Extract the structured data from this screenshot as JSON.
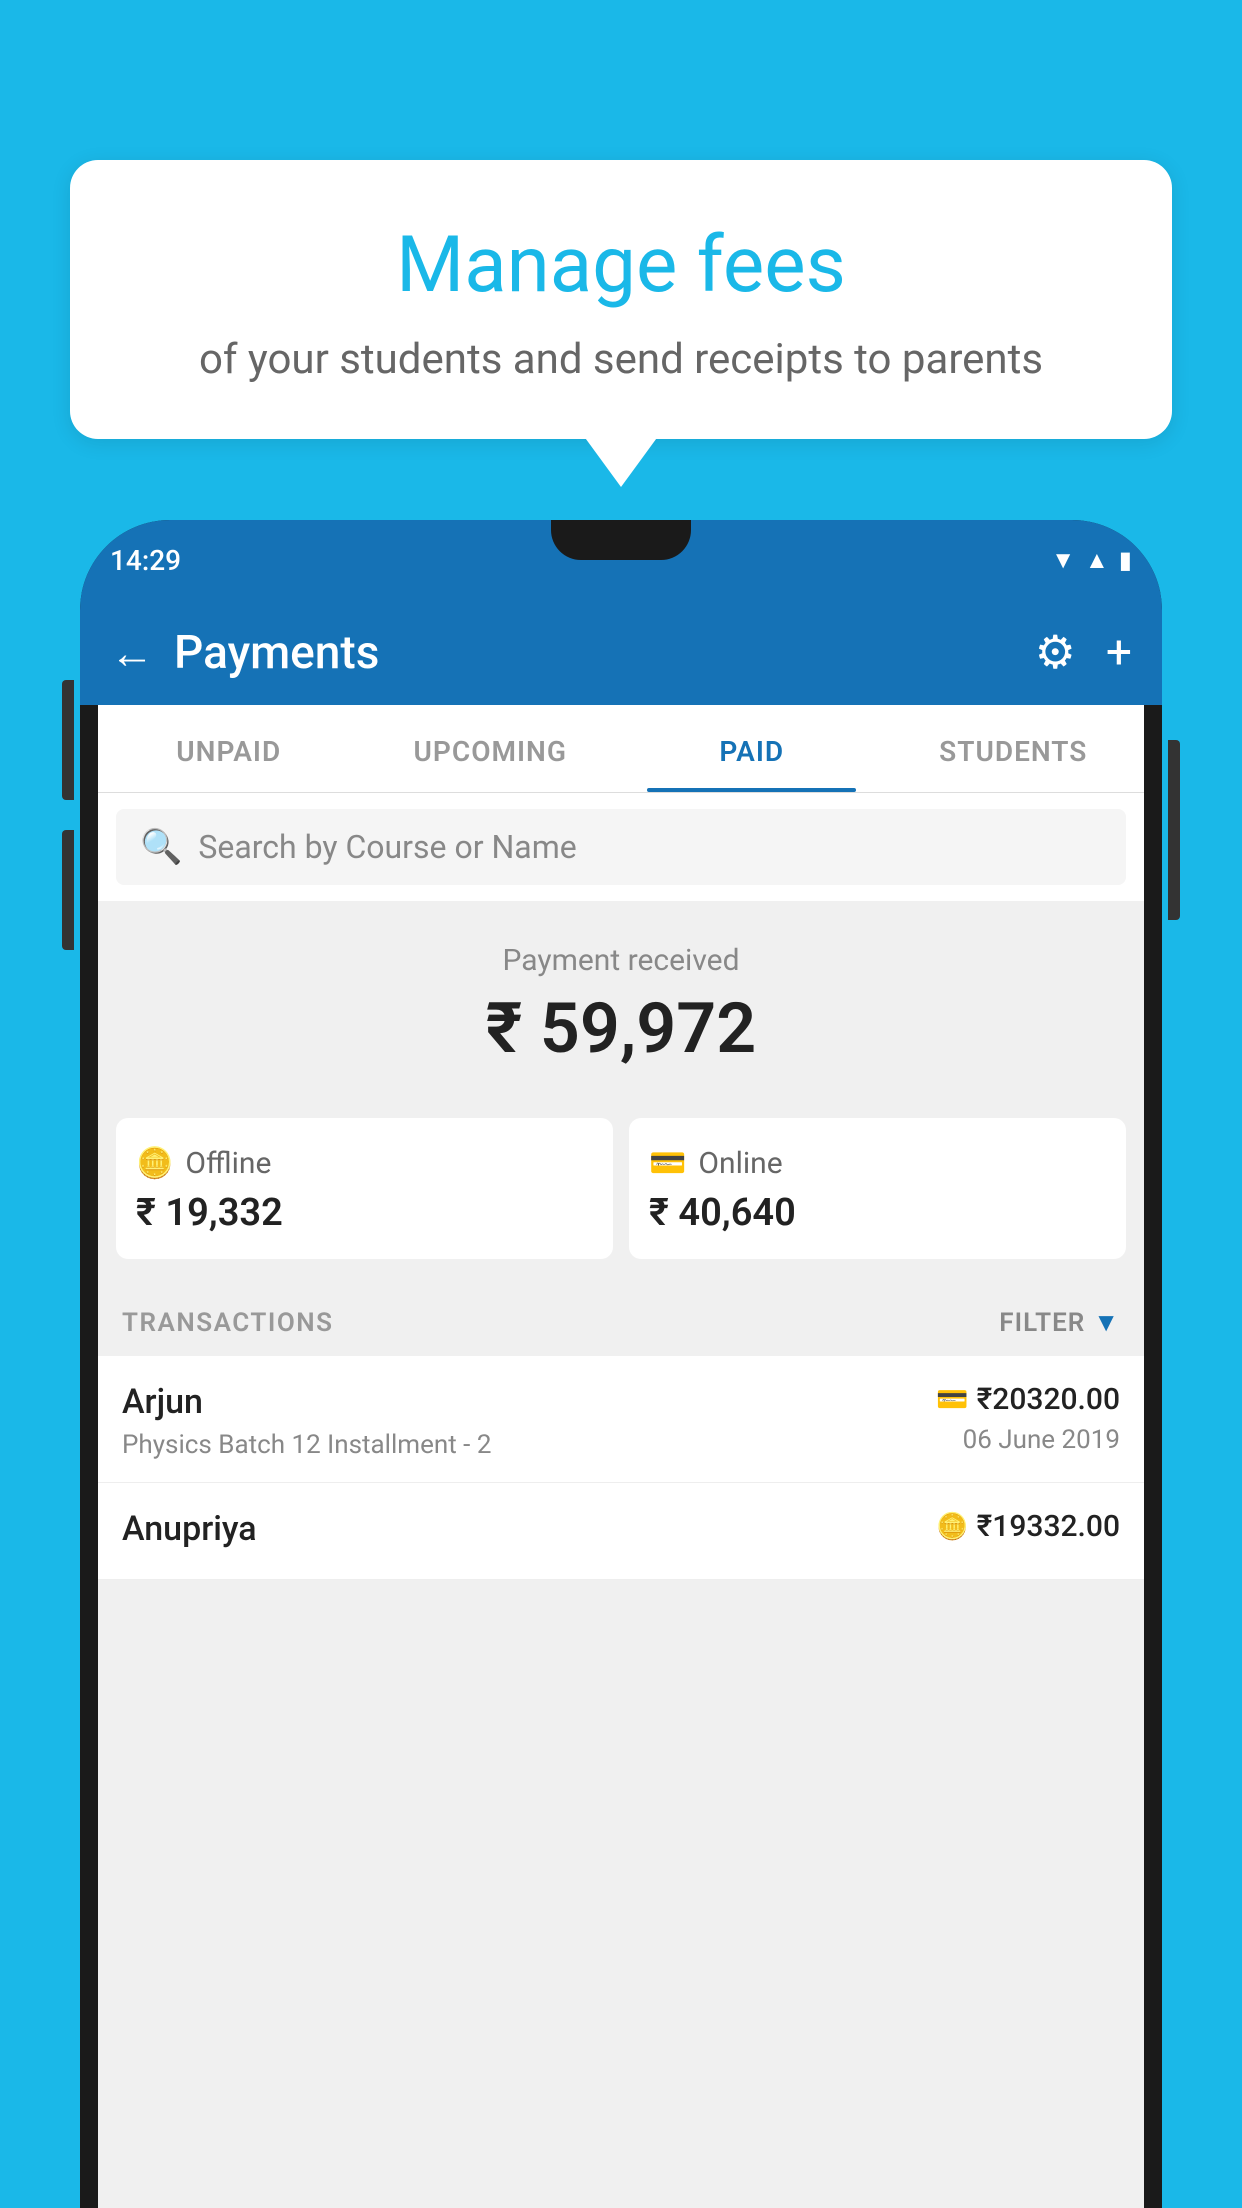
{
  "bubble": {
    "title": "Manage fees",
    "subtitle": "of your students and send receipts to parents"
  },
  "phone": {
    "status_time": "14:29",
    "app_bar": {
      "title": "Payments",
      "back_label": "←",
      "settings_label": "⚙",
      "add_label": "+"
    },
    "tabs": [
      {
        "label": "UNPAID",
        "active": false
      },
      {
        "label": "UPCOMING",
        "active": false
      },
      {
        "label": "PAID",
        "active": true
      },
      {
        "label": "STUDENTS",
        "active": false
      }
    ],
    "search": {
      "placeholder": "Search by Course or Name"
    },
    "summary": {
      "label": "Payment received",
      "amount": "₹ 59,972"
    },
    "payment_types": [
      {
        "icon": "💳",
        "label": "Offline",
        "amount": "₹ 19,332"
      },
      {
        "icon": "💳",
        "label": "Online",
        "amount": "₹ 40,640"
      }
    ],
    "transactions_label": "TRANSACTIONS",
    "filter_label": "FILTER",
    "transactions": [
      {
        "name": "Arjun",
        "detail": "Physics Batch 12 Installment - 2",
        "amount": "₹20320.00",
        "date": "06 June 2019",
        "icon": "💳"
      },
      {
        "name": "Anupriya",
        "detail": "",
        "amount": "₹19332.00",
        "date": "",
        "icon": "🪙"
      }
    ]
  }
}
